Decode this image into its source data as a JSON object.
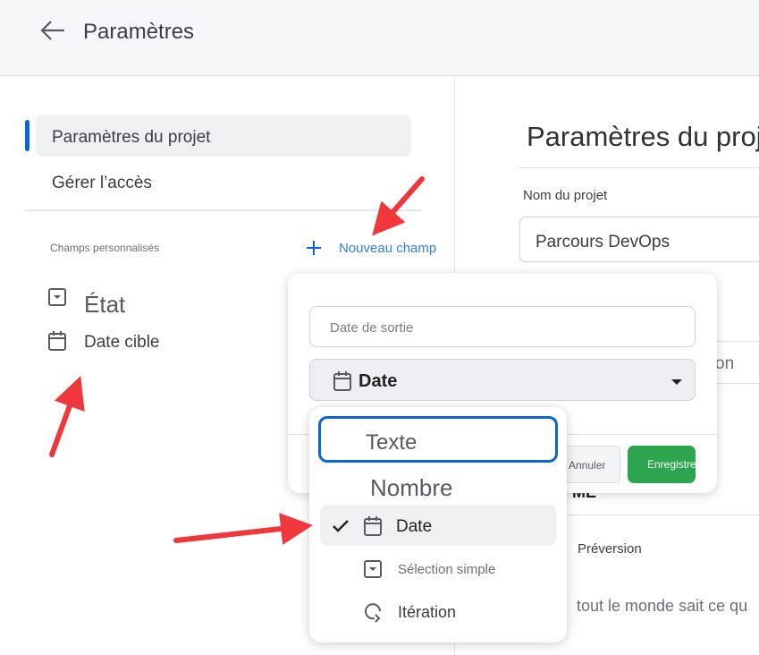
{
  "header": {
    "title": "Paramètres",
    "back_icon": "arrow-left-icon"
  },
  "sidebar": {
    "items": [
      {
        "label": "Paramètres du projet",
        "active": true
      },
      {
        "label": "Gérer l’accès"
      }
    ],
    "custom_fields_label": "Champs personnalisés",
    "new_field_label": "Nouveau champ",
    "fields": [
      {
        "label": "État",
        "icon": "single-select-icon"
      },
      {
        "label": "Date cible",
        "icon": "calendar-icon"
      }
    ]
  },
  "main": {
    "title": "Paramètres du proj",
    "project_name_label": "Nom du projet",
    "project_name_value": "Parcours DevOps",
    "partial_text_1": "on",
    "partial_text_2": "ME",
    "preview_label": "Préversion",
    "partial_text_3": "tout le monde sait ce qu"
  },
  "popup": {
    "field_name_placeholder": "Date de sortie",
    "type_selected": "Date",
    "cancel_label": "Annuler",
    "save_label": "Enregistrer"
  },
  "type_menu": {
    "options": [
      {
        "label": "Texte",
        "focused": true
      },
      {
        "label": "Nombre"
      },
      {
        "label": "Date",
        "selected": true,
        "icon": "calendar-icon"
      },
      {
        "label": "Sélection simple",
        "icon": "single-select-icon"
      },
      {
        "label": "Itération",
        "icon": "iteration-icon"
      }
    ]
  },
  "colors": {
    "accent": "#0a66d8",
    "save": "#2da44e",
    "annotation_arrow": "#f0383c"
  }
}
